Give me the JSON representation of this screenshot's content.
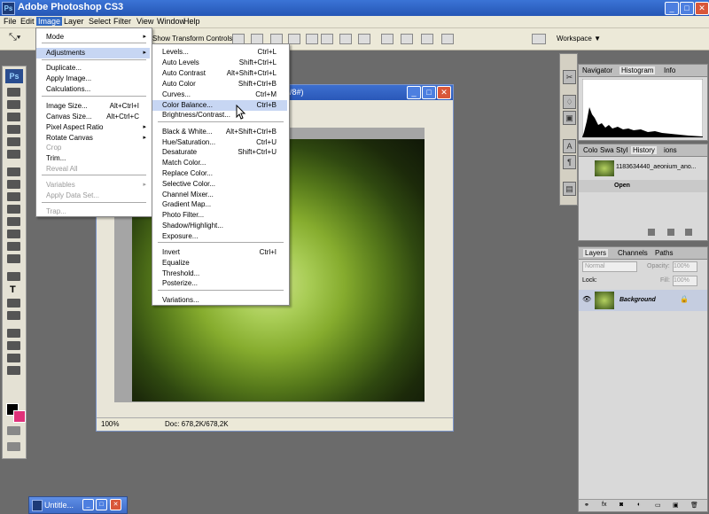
{
  "window": {
    "title": "Adobe Photoshop CS3",
    "logo": "Ps"
  },
  "menubar": [
    "File",
    "Edit",
    "Image",
    "Layer",
    "Select",
    "Filter",
    "View",
    "Window",
    "Help"
  ],
  "optionsbar": {
    "transform_label": "Show Transform Controls",
    "workspace_label": "Workspace ▼"
  },
  "image_menu": {
    "items": [
      {
        "label": "Mode",
        "shortcut": "",
        "arrow": "▸",
        "disabled": false
      },
      {
        "label": "Adjustments",
        "shortcut": "",
        "arrow": "▸",
        "disabled": false
      },
      {
        "label": "Duplicate...",
        "shortcut": "",
        "arrow": "",
        "disabled": false
      },
      {
        "label": "Apply Image...",
        "shortcut": "",
        "arrow": "",
        "disabled": false
      },
      {
        "label": "Calculations...",
        "shortcut": "",
        "arrow": "",
        "disabled": false
      },
      {
        "label": "Image Size...",
        "shortcut": "Alt+Ctrl+I",
        "arrow": "",
        "disabled": false
      },
      {
        "label": "Canvas Size...",
        "shortcut": "Alt+Ctrl+C",
        "arrow": "",
        "disabled": false
      },
      {
        "label": "Pixel Aspect Ratio",
        "shortcut": "",
        "arrow": "▸",
        "disabled": false
      },
      {
        "label": "Rotate Canvas",
        "shortcut": "",
        "arrow": "▸",
        "disabled": false
      },
      {
        "label": "Crop",
        "shortcut": "",
        "arrow": "",
        "disabled": true
      },
      {
        "label": "Trim...",
        "shortcut": "",
        "arrow": "",
        "disabled": false
      },
      {
        "label": "Reveal All",
        "shortcut": "",
        "arrow": "",
        "disabled": true
      },
      {
        "label": "Variables",
        "shortcut": "",
        "arrow": "▸",
        "disabled": true
      },
      {
        "label": "Apply Data Set...",
        "shortcut": "",
        "arrow": "",
        "disabled": true
      },
      {
        "label": "Trap...",
        "shortcut": "",
        "arrow": "",
        "disabled": true
      }
    ]
  },
  "adjustments_menu": {
    "items": [
      {
        "label": "Levels...",
        "shortcut": "Ctrl+L"
      },
      {
        "label": "Auto Levels",
        "shortcut": "Shift+Ctrl+L"
      },
      {
        "label": "Auto Contrast",
        "shortcut": "Alt+Shift+Ctrl+L"
      },
      {
        "label": "Auto Color",
        "shortcut": "Shift+Ctrl+B"
      },
      {
        "label": "Curves...",
        "shortcut": "Ctrl+M"
      },
      {
        "label": "Color Balance...",
        "shortcut": "Ctrl+B"
      },
      {
        "label": "Brightness/Contrast...",
        "shortcut": ""
      },
      {
        "label": "Black & White...",
        "shortcut": "Alt+Shift+Ctrl+B"
      },
      {
        "label": "Hue/Saturation...",
        "shortcut": "Ctrl+U"
      },
      {
        "label": "Desaturate",
        "shortcut": "Shift+Ctrl+U"
      },
      {
        "label": "Match Color...",
        "shortcut": ""
      },
      {
        "label": "Replace Color...",
        "shortcut": ""
      },
      {
        "label": "Selective Color...",
        "shortcut": ""
      },
      {
        "label": "Channel Mixer...",
        "shortcut": ""
      },
      {
        "label": "Gradient Map...",
        "shortcut": ""
      },
      {
        "label": "Photo Filter...",
        "shortcut": ""
      },
      {
        "label": "Shadow/Highlight...",
        "shortcut": ""
      },
      {
        "label": "Exposure...",
        "shortcut": ""
      },
      {
        "label": "Invert",
        "shortcut": "Ctrl+I"
      },
      {
        "label": "Equalize",
        "shortcut": ""
      },
      {
        "label": "Threshold...",
        "shortcut": ""
      },
      {
        "label": "Posterize...",
        "shortcut": ""
      },
      {
        "label": "Variations...",
        "shortcut": ""
      }
    ]
  },
  "document": {
    "title_fragment": "B/8#)",
    "zoom": "100%",
    "doc_size": "Doc: 678,2K/678,2K"
  },
  "navigator_panel": {
    "tabs": [
      "Navigator",
      "Histogram",
      "Info"
    ]
  },
  "history_panel": {
    "tabs": [
      "Colo",
      "Swa",
      "Styl",
      "History",
      "ions"
    ],
    "snapshot_name": "1183634440_aeonium_ano...",
    "step": "Open"
  },
  "layers_panel": {
    "tabs": [
      "Layers",
      "Channels",
      "Paths"
    ],
    "blend_mode": "Normal",
    "opacity_label": "Opacity:",
    "opacity": "100%",
    "lock_label": "Lock:",
    "fill_label": "Fill:",
    "fill": "100%",
    "layer_name": "Background"
  },
  "minimized": {
    "title": "Untitle..."
  }
}
